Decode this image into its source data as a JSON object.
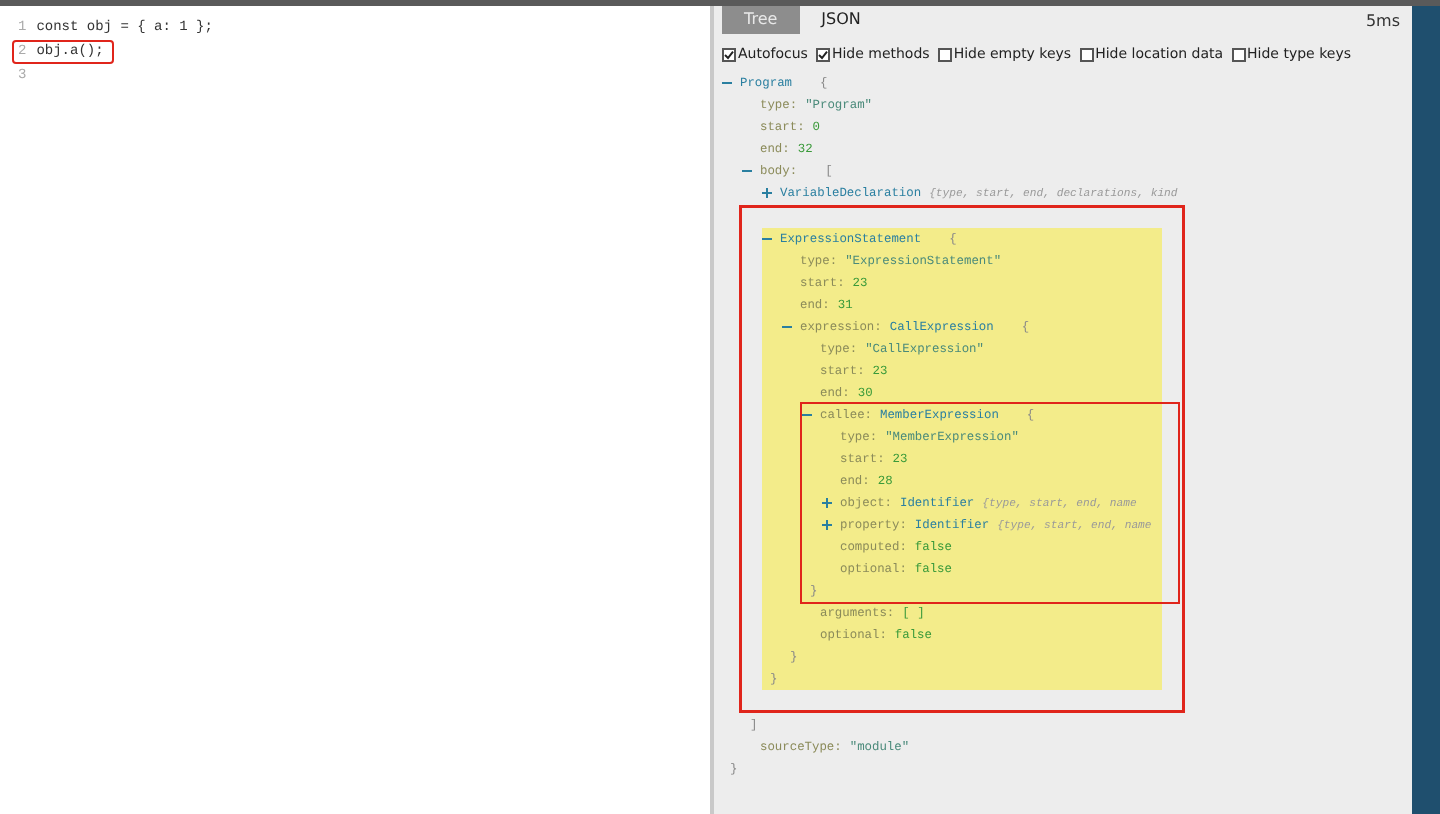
{
  "editor": {
    "lines": [
      {
        "number": "1",
        "code": "const obj = { a: 1 };"
      },
      {
        "number": "2",
        "code": "obj.a();",
        "outlined": true
      },
      {
        "number": "3"
      }
    ]
  },
  "tabs": [
    {
      "label": "Tree",
      "selected": true
    },
    {
      "label": "JSON",
      "selected": false
    }
  ],
  "timing": "5ms",
  "options": [
    {
      "label": "Autofocus",
      "checked": true
    },
    {
      "label": "Hide methods",
      "checked": true
    },
    {
      "label": "Hide empty keys",
      "checked": false
    },
    {
      "label": "Hide location data",
      "checked": false
    },
    {
      "label": "Hide type keys",
      "checked": false
    }
  ],
  "tree": [
    {
      "kind": "node",
      "type": "Program",
      "open": "{",
      "close": "}",
      "expanded": true,
      "children": [
        {
          "kind": "prop",
          "key": "type:",
          "value": "\"Program\""
        },
        {
          "kind": "prop",
          "key": "start:",
          "value": "0"
        },
        {
          "kind": "prop",
          "key": "end:",
          "value": "32"
        },
        {
          "kind": "node",
          "key": "body:",
          "open": "[",
          "close": "]",
          "expanded": true,
          "children": [
            {
              "kind": "node",
              "type": "VariableDeclaration",
              "summary": "{type, start, end, declarations, kind",
              "expanded": false
            },
            {
              "kind": "node",
              "type": "ExpressionStatement",
              "open": "{",
              "close": "}",
              "expanded": true,
              "highlighted": true,
              "outlined": true,
              "children": [
                {
                  "kind": "prop",
                  "key": "type:",
                  "value": "\"ExpressionStatement\""
                },
                {
                  "kind": "prop",
                  "key": "start:",
                  "value": "23"
                },
                {
                  "kind": "prop",
                  "key": "end:",
                  "value": "31"
                },
                {
                  "kind": "node",
                  "key": "expression:",
                  "type": "CallExpression",
                  "open": "{",
                  "close": "}",
                  "expanded": true,
                  "children": [
                    {
                      "kind": "prop",
                      "key": "type:",
                      "value": "\"CallExpression\""
                    },
                    {
                      "kind": "prop",
                      "key": "start:",
                      "value": "23"
                    },
                    {
                      "kind": "prop",
                      "key": "end:",
                      "value": "30"
                    },
                    {
                      "kind": "node",
                      "key": "callee:",
                      "type": "MemberExpression",
                      "open": "{",
                      "close": "}",
                      "expanded": true,
                      "outlined": true,
                      "children": [
                        {
                          "kind": "prop",
                          "key": "type:",
                          "value": "\"MemberExpression\""
                        },
                        {
                          "kind": "prop",
                          "key": "start:",
                          "value": "23"
                        },
                        {
                          "kind": "prop",
                          "key": "end:",
                          "value": "28"
                        },
                        {
                          "kind": "node",
                          "key": "object:",
                          "type": "Identifier",
                          "summary": "{type, start, end, name",
                          "expanded": false
                        },
                        {
                          "kind": "node",
                          "key": "property:",
                          "type": "Identifier",
                          "summary": "{type, start, end, name",
                          "expanded": false
                        },
                        {
                          "kind": "prop",
                          "key": "computed:",
                          "value": "false"
                        },
                        {
                          "kind": "prop",
                          "key": "optional:",
                          "value": "false"
                        }
                      ]
                    },
                    {
                      "kind": "prop",
                      "key": "arguments:",
                      "value": "[ ]"
                    },
                    {
                      "kind": "prop",
                      "key": "optional:",
                      "value": "false"
                    }
                  ]
                }
              ]
            }
          ]
        },
        {
          "kind": "prop",
          "key": "sourceType:",
          "value": "\"module\""
        }
      ]
    }
  ]
}
